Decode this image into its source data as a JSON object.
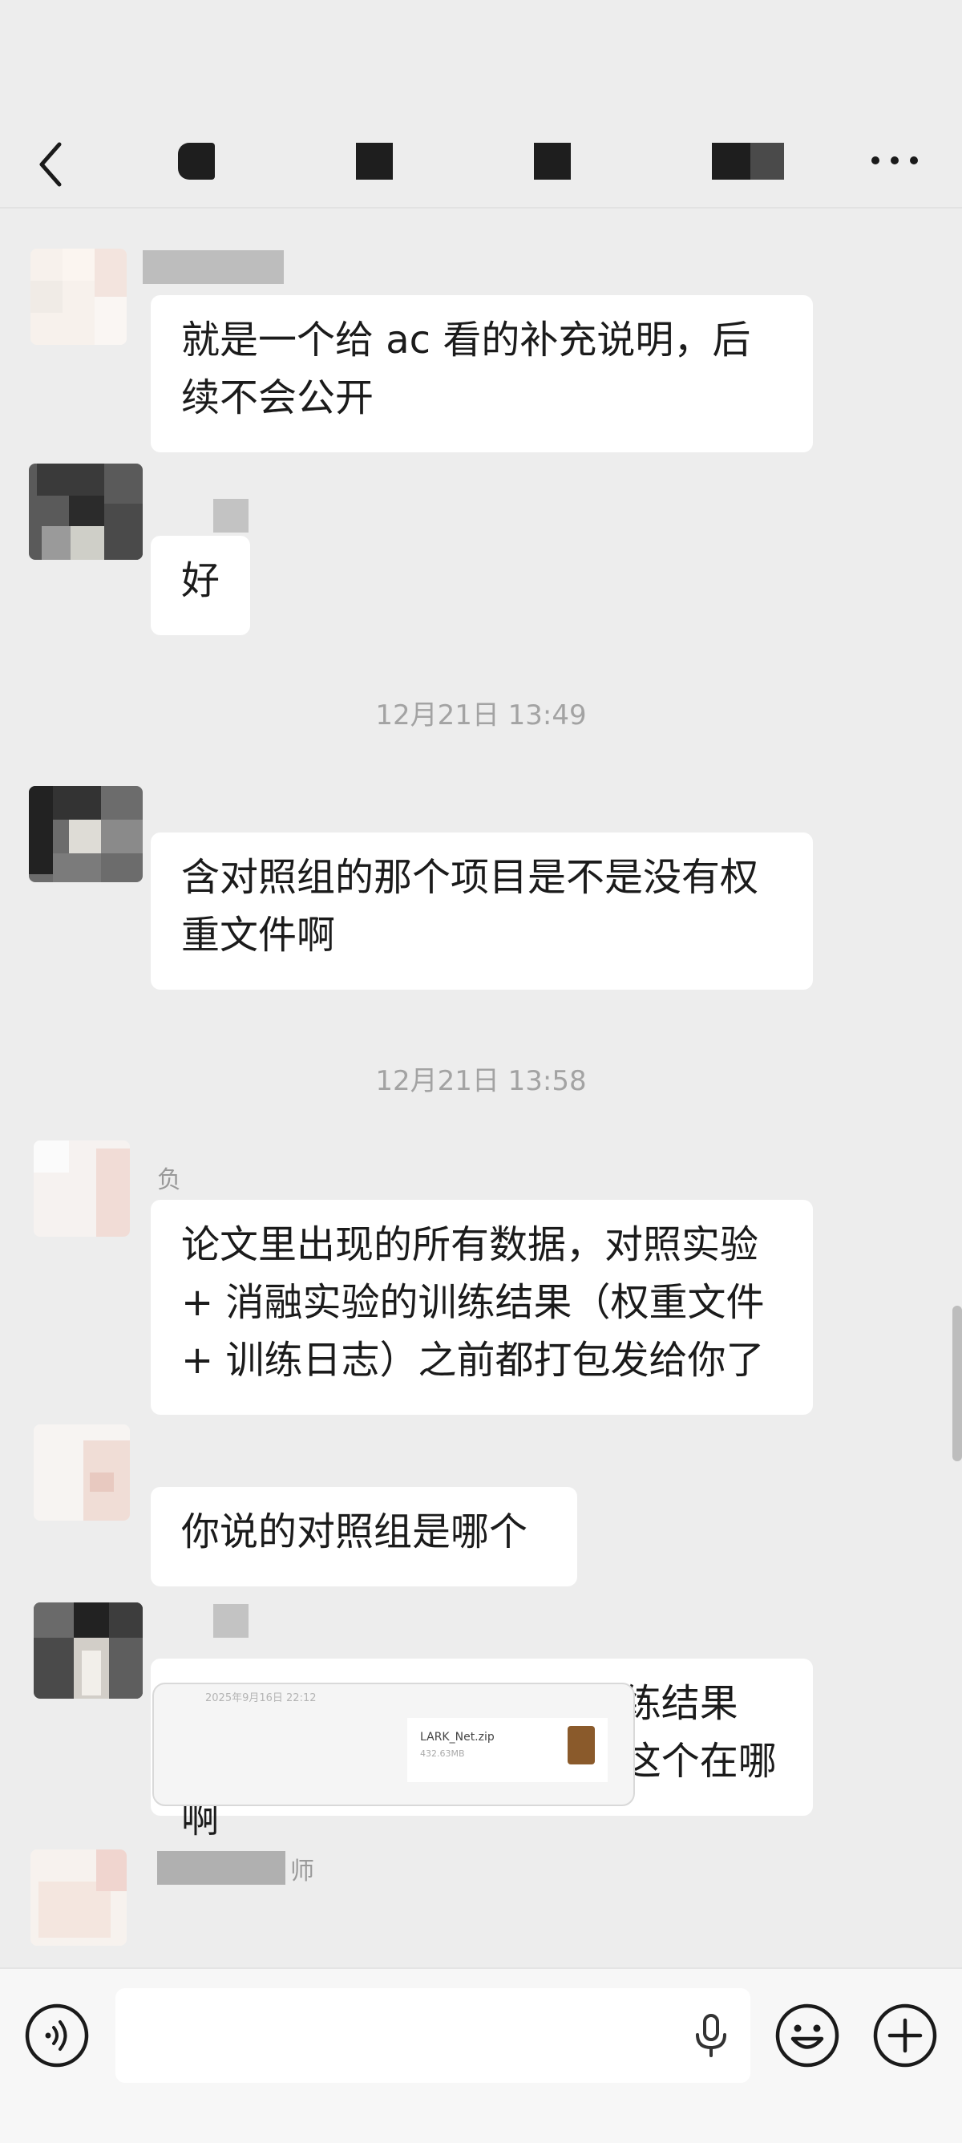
{
  "header": {
    "back_icon": "chevron-left-icon",
    "more_icon": "more-horizontal-icon",
    "title_redacted": true
  },
  "messages": [
    {
      "sender": "",
      "text": "就是一个给 ac 看的补充说明，后\n续不会公开"
    },
    {
      "sender": "",
      "text": "好"
    },
    {
      "text": "含对照组的那个项目是不是没有权\n重文件啊"
    },
    {
      "sender": "负",
      "text": "论文里出现的所有数据，对照实验\n+ 消融实验的训练结果（权重文件\n+ 训练日志）之前都打包发给你了"
    },
    {
      "text": "你说的对照组是哪个"
    },
    {
      "text": "对照实验 + 消融实验的训练结果\n（权重文件 + 训练日志）这个在哪啊"
    },
    {
      "sender": "师"
    }
  ],
  "timestamps": [
    "12月21日 13:49",
    "12月21日 13:58"
  ],
  "file_card": {
    "date": "2025年9月16日 22:12",
    "file_name": "LARK_Net.zip",
    "file_size": "432.63MB",
    "icon": "zip-file-icon"
  },
  "bottom_bar": {
    "voice_icon": "voice-mode-icon",
    "mic_icon": "microphone-icon",
    "emoji_icon": "emoji-icon",
    "plus_icon": "plus-icon",
    "input_value": "",
    "input_placeholder": ""
  }
}
